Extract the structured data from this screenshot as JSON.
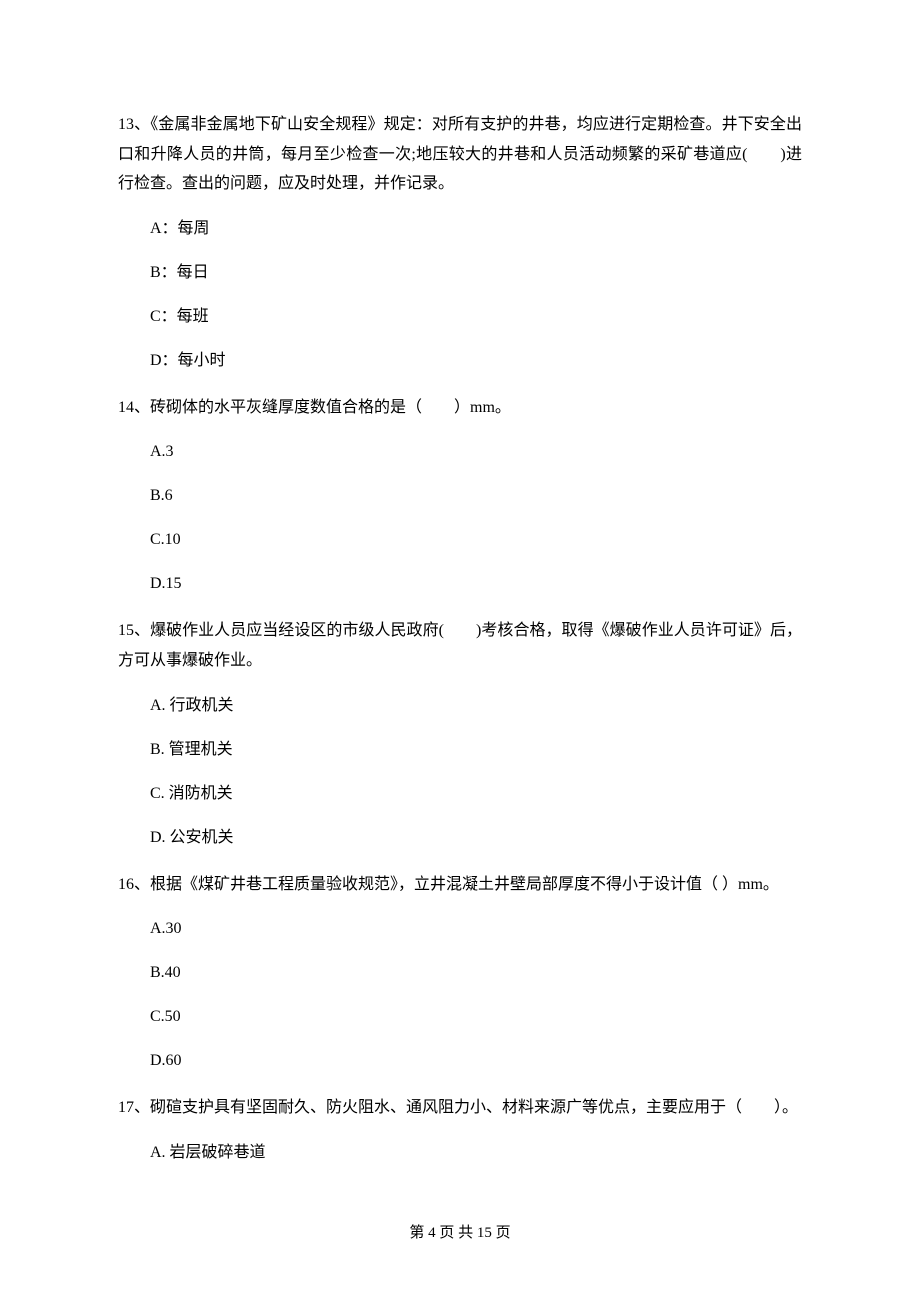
{
  "questions": [
    {
      "number": "13、",
      "text": "《金属非金属地下矿山安全规程》规定：对所有支护的井巷，均应进行定期检查。井下安全出口和升降人员的井筒，每月至少检查一次;地压较大的井巷和人员活动频繁的采矿巷道应(　　)进行检查。查出的问题，应及时处理，并作记录。",
      "options": [
        "A：每周",
        "B：每日",
        "C：每班",
        "D：每小时"
      ]
    },
    {
      "number": "14、",
      "text": "砖砌体的水平灰缝厚度数值合格的是（　　）mm。",
      "options": [
        "A.3",
        "B.6",
        "C.10",
        "D.15"
      ]
    },
    {
      "number": "15、",
      "text": "爆破作业人员应当经设区的市级人民政府(　　)考核合格，取得《爆破作业人员许可证》后，方可从事爆破作业。",
      "options": [
        "A. 行政机关",
        "B. 管理机关",
        "C. 消防机关",
        "D. 公安机关"
      ]
    },
    {
      "number": "16、",
      "text": "根据《煤矿井巷工程质量验收规范》，立井混凝土井壁局部厚度不得小于设计值（ ）mm。",
      "options": [
        "A.30",
        "B.40",
        "C.50",
        "D.60"
      ]
    },
    {
      "number": "17、",
      "text": "砌碹支护具有坚固耐久、防火阻水、通风阻力小、材料来源广等优点，主要应用于（　　）。",
      "options": [
        "A. 岩层破碎巷道"
      ]
    }
  ],
  "footer": "第 4 页 共 15 页"
}
